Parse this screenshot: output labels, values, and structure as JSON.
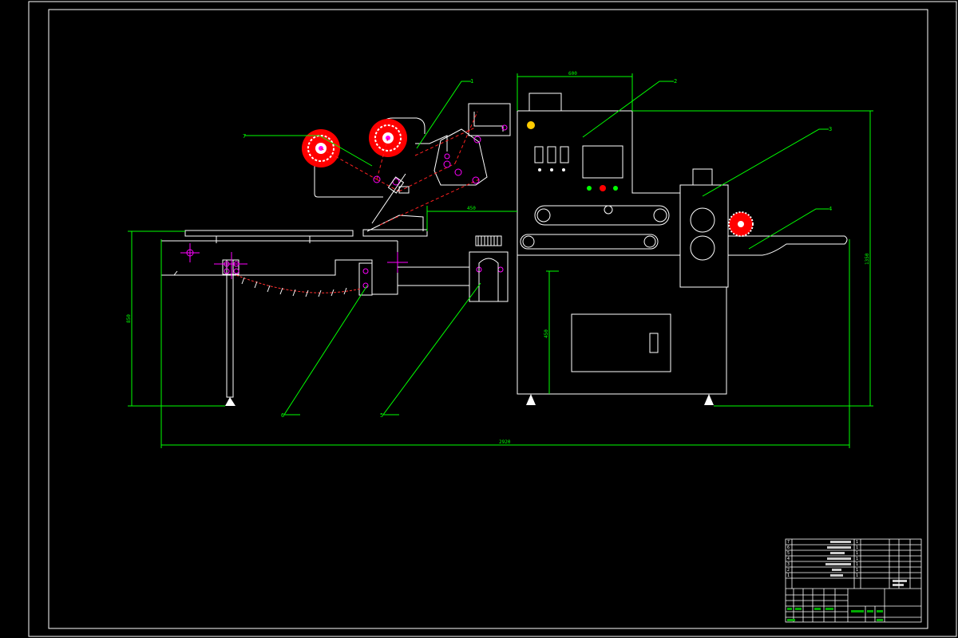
{
  "drawing": {
    "dimensions": {
      "top_width": "600",
      "feed_length": "450",
      "overall_length": "2920",
      "left_height": "850",
      "mid_height": "450",
      "right_height": "1350"
    },
    "callouts": [
      "1",
      "2",
      "3",
      "4",
      "5",
      "6",
      "7"
    ]
  },
  "title_block": {
    "part_rows": [
      {
        "no": "7",
        "name": "",
        "qty": "1"
      },
      {
        "no": "6",
        "name": "",
        "qty": "1"
      },
      {
        "no": "5",
        "name": "",
        "qty": "1"
      },
      {
        "no": "4",
        "name": "",
        "qty": "1"
      },
      {
        "no": "3",
        "name": "",
        "qty": "1"
      },
      {
        "no": "2",
        "name": "",
        "qty": "1"
      },
      {
        "no": "1",
        "name": "",
        "qty": "1"
      }
    ]
  },
  "colors": {
    "line": "#ffffff",
    "dimension": "#00ff00",
    "accent": "#ff0000",
    "center": "#ff00ff",
    "lamp": "#ffcc00"
  }
}
